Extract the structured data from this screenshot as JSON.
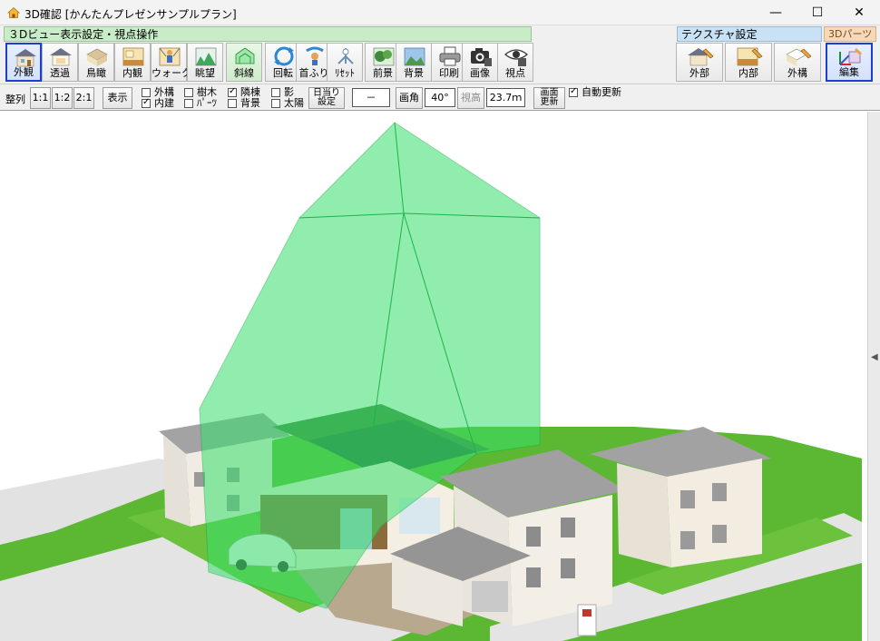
{
  "window": {
    "title": "3D確認 [かんたんプレゼンサンプルプラン]",
    "minimize_glyph": "—",
    "maximize_glyph": "☐",
    "close_glyph": "✕"
  },
  "groups": {
    "view3d": "３Dビュー表示設定・視点操作",
    "texture": "テクスチャ設定",
    "parts": "3Dパーツ"
  },
  "view_buttons": [
    {
      "label": "外観",
      "icon": "house-exterior-icon",
      "active": true
    },
    {
      "label": "透過",
      "icon": "house-transparent-icon"
    },
    {
      "label": "鳥瞰",
      "icon": "birds-eye-icon"
    },
    {
      "label": "内観",
      "icon": "interior-view-icon"
    },
    {
      "label": "ウォーク",
      "icon": "walk-person-icon"
    },
    {
      "label": "眺望",
      "icon": "landscape-view-icon"
    },
    {
      "label": "斜線",
      "icon": "setback-line-icon"
    },
    {
      "label": "回転",
      "icon": "rotate-icon"
    },
    {
      "label": "首ふり",
      "icon": "head-turn-icon"
    },
    {
      "label": "ﾘｾｯﾄ",
      "icon": "reset-icon"
    },
    {
      "label": "前景",
      "icon": "foreground-icon"
    },
    {
      "label": "背景",
      "icon": "background-icon"
    },
    {
      "label": "印刷",
      "icon": "printer-icon"
    },
    {
      "label": "画像",
      "icon": "camera-icon"
    },
    {
      "label": "視点",
      "icon": "eye-viewpoint-icon"
    }
  ],
  "texture_buttons": [
    {
      "label": "外部",
      "icon": "exterior-texture-icon"
    },
    {
      "label": "内部",
      "icon": "interior-texture-icon"
    },
    {
      "label": "外構",
      "icon": "landscape-texture-icon"
    }
  ],
  "parts_buttons": [
    {
      "label": "編集",
      "icon": "edit-parts-icon",
      "active": true
    }
  ],
  "controls": {
    "align_label": "整列",
    "ratio_1_1": "1:1",
    "ratio_1_2": "1:2",
    "ratio_2_1": "2:1",
    "display_button": "表示",
    "checks": {
      "gaiko": {
        "label": "外構",
        "checked": false
      },
      "naiken": {
        "label": "内建",
        "checked": true
      },
      "jumoku": {
        "label": "樹木",
        "checked": false
      },
      "parts": {
        "label": "ﾊﾟｰﾂ",
        "checked": false
      },
      "rinto": {
        "label": "隣棟",
        "checked": true
      },
      "haikei": {
        "label": "背景",
        "checked": false
      },
      "kage": {
        "label": "影",
        "checked": false
      },
      "taiyo": {
        "label": "太陽",
        "checked": false
      }
    },
    "sunlight_line1": "日当り",
    "sunlight_line2": "設定",
    "dash_field": "－",
    "angle_label": "画角",
    "angle_value": "40°",
    "height_label": "視高",
    "height_value": "23.7ｍ",
    "refresh_line1": "画面",
    "refresh_line2": "更新",
    "auto_refresh": {
      "label": "自動更新",
      "checked": true
    }
  },
  "colors": {
    "ground_green": "#5cb833",
    "road": "#e4e4e4",
    "setback_volume": "#36e06b",
    "solar": "#2a7f3e",
    "roof_grey": "#9a9a9a",
    "wall_cream": "#efe9df"
  }
}
